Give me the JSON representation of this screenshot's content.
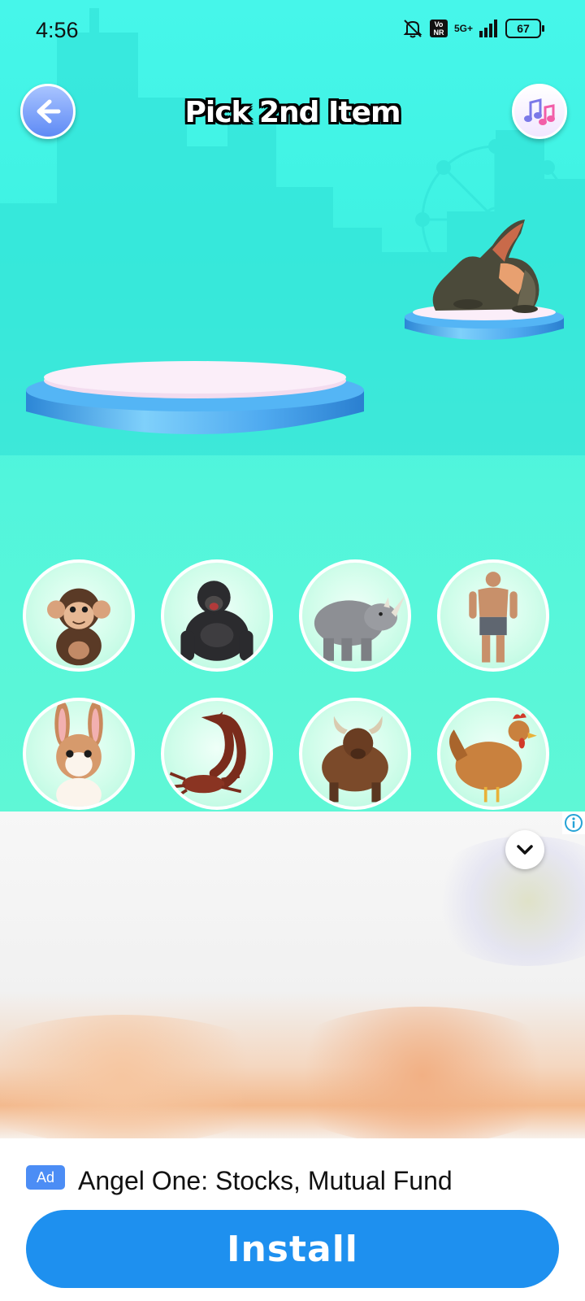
{
  "status_bar": {
    "time": "4:56",
    "network_top": "5G+",
    "volte_badge": "Vo\nNR",
    "battery": "67"
  },
  "header": {
    "title": "Pick 2nd Item",
    "back_icon": "arrow-left-icon",
    "music_icon": "music-notes-icon"
  },
  "stage": {
    "first_pick": "crocodile",
    "second_pick": ""
  },
  "items": [
    {
      "name": "monkey"
    },
    {
      "name": "gorilla"
    },
    {
      "name": "rhino"
    },
    {
      "name": "bodybuilder"
    },
    {
      "name": "rabbit"
    },
    {
      "name": "scorpion"
    },
    {
      "name": "bull"
    },
    {
      "name": "rooster"
    }
  ],
  "ad": {
    "badge": "Ad",
    "title": "Angel One: Stocks, Mutual Fund",
    "install_label": "Install",
    "info_icon": "info-icon",
    "collapse_icon": "chevron-down-icon"
  },
  "colors": {
    "background": "#46f6ea",
    "podium_blue": "#3d9be6",
    "podium_top": "#f6e9f4",
    "install_blue": "#1e90ef",
    "ad_badge": "#4c8df5"
  }
}
